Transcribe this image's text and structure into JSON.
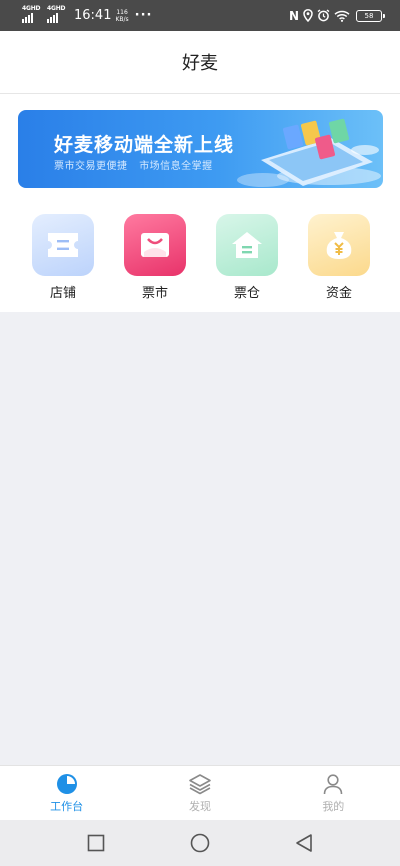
{
  "status_bar": {
    "net1": "4GHD",
    "net2": "4GHD",
    "time": "16:41",
    "speed_value": "116",
    "speed_unit": "KB/s",
    "dots": "···",
    "nfc": "N",
    "battery": "58"
  },
  "header": {
    "title": "好麦"
  },
  "banner": {
    "title": "好麦移动端全新上线",
    "sub1": "票市交易更便捷",
    "sub2": "市场信息全掌握"
  },
  "quick_actions": [
    {
      "label": "店铺",
      "icon": "ticket-icon",
      "color": "#7aaaf3"
    },
    {
      "label": "票市",
      "icon": "bag-icon",
      "color": "#ef4d7b"
    },
    {
      "label": "票仓",
      "icon": "house-icon",
      "color": "#5fcfa0"
    },
    {
      "label": "资金",
      "icon": "money-bag-icon",
      "color": "#f5c75a"
    }
  ],
  "tabbar": [
    {
      "label": "工作台",
      "icon": "pie-chart-icon",
      "active": true
    },
    {
      "label": "发现",
      "icon": "layers-icon",
      "active": false
    },
    {
      "label": "我的",
      "icon": "user-icon",
      "active": false
    }
  ],
  "colors": {
    "accent": "#1f90e6",
    "page_bg": "#eff0f4"
  }
}
